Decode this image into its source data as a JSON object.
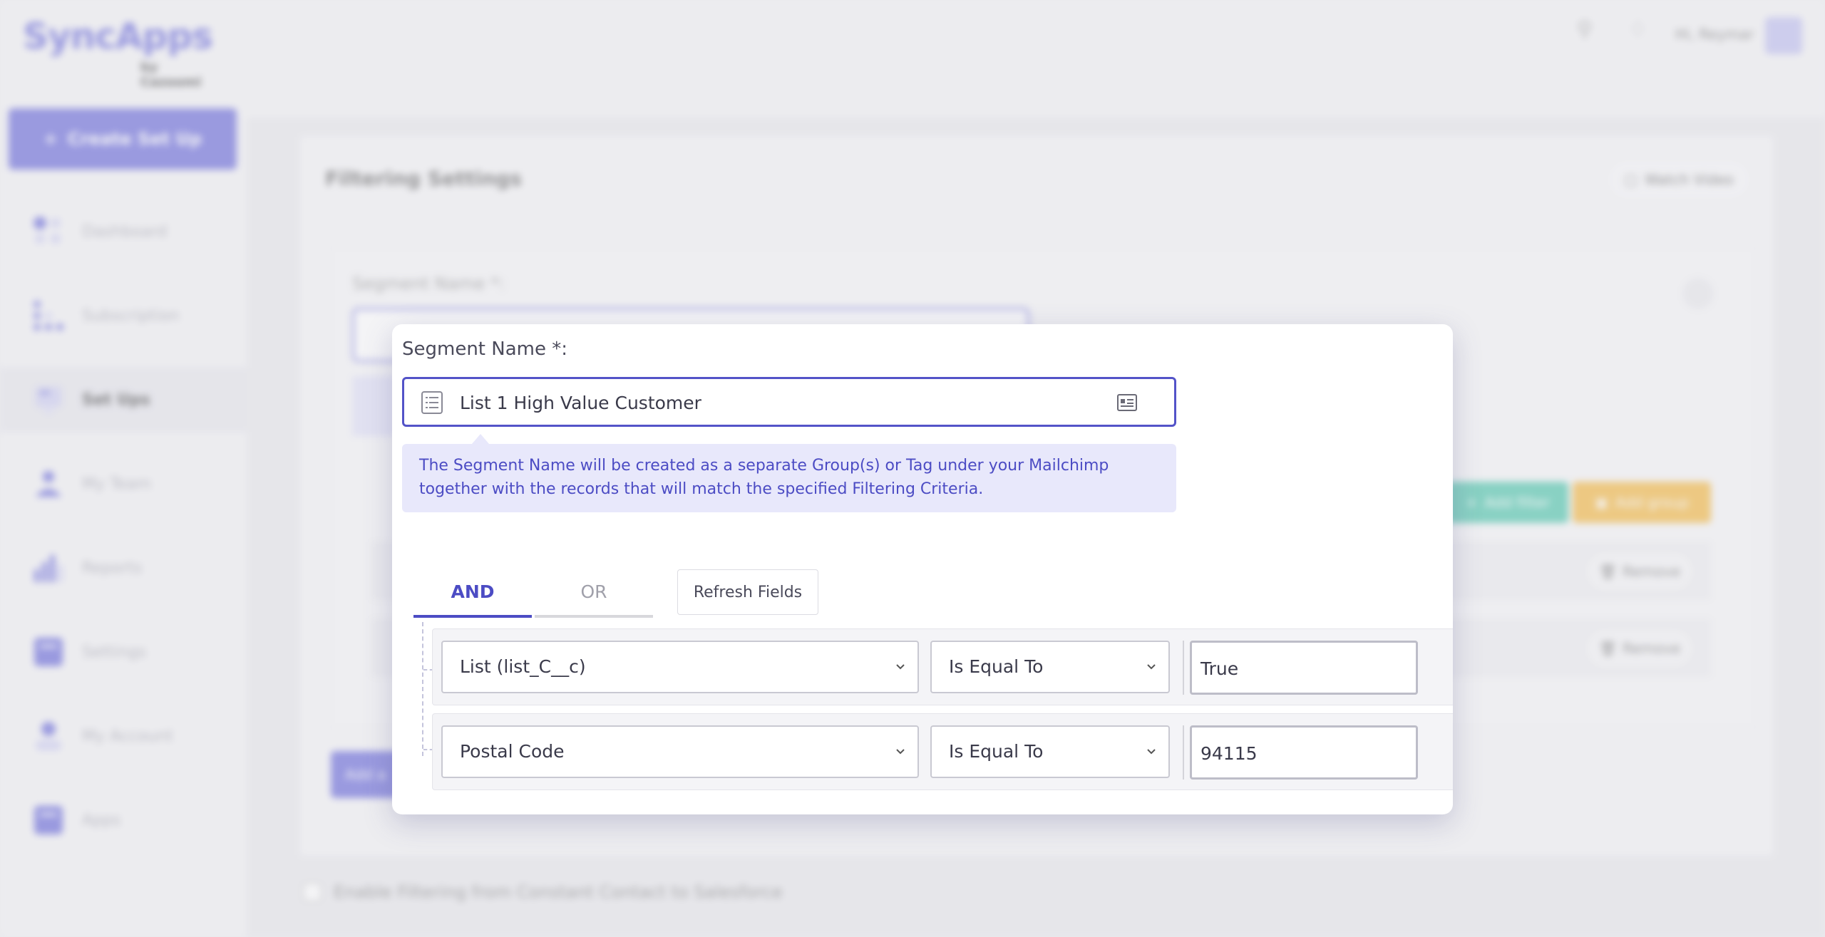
{
  "app": {
    "logo_main": "SyncApps",
    "logo_sub": "by Cazoomi",
    "greeting": "Hi, Reymar"
  },
  "sidebar": {
    "create_button": "Create Set Up",
    "items": [
      {
        "label": "Dashboard",
        "icon": "dashboard-icon"
      },
      {
        "label": "Subscription",
        "icon": "subscription-icon"
      },
      {
        "label": "Set Ups",
        "icon": "setups-icon",
        "active": true
      },
      {
        "label": "My Team",
        "icon": "team-icon"
      },
      {
        "label": "Reports",
        "icon": "reports-icon"
      },
      {
        "label": "Settings",
        "icon": "settings-icon"
      },
      {
        "label": "My Account",
        "icon": "account-icon"
      },
      {
        "label": "Apps",
        "icon": "apps-icon"
      }
    ]
  },
  "background": {
    "card_title": "Filtering Settings",
    "watch_video": "Watch Video",
    "segment_label": "Segment Name *:",
    "add_filter": "Add filter",
    "add_group": "Add group",
    "remove": "Remove",
    "add_button": "Add a",
    "checkbox_label": "Enable Filtering from Constant Contact to Salesforce"
  },
  "modal": {
    "segment_label": "Segment Name *:",
    "segment_value": "List 1 High Value Customer",
    "info_text": "The Segment Name will be created as a separate Group(s) or Tag under your Mailchimp together with the records that will match the specified Filtering Criteria.",
    "tab_and": "AND",
    "tab_or": "OR",
    "refresh_button": "Refresh Fields",
    "filters": [
      {
        "field": "List (list_C__c)",
        "operator": "Is Equal To",
        "value": "True"
      },
      {
        "field": "Postal Code",
        "operator": "Is Equal To",
        "value": "94115"
      }
    ]
  },
  "colors": {
    "accent": "#4c4cc4",
    "info_bg": "#e8e8fb",
    "add_filter": "#3cc0a3",
    "add_group": "#f2b02d"
  }
}
